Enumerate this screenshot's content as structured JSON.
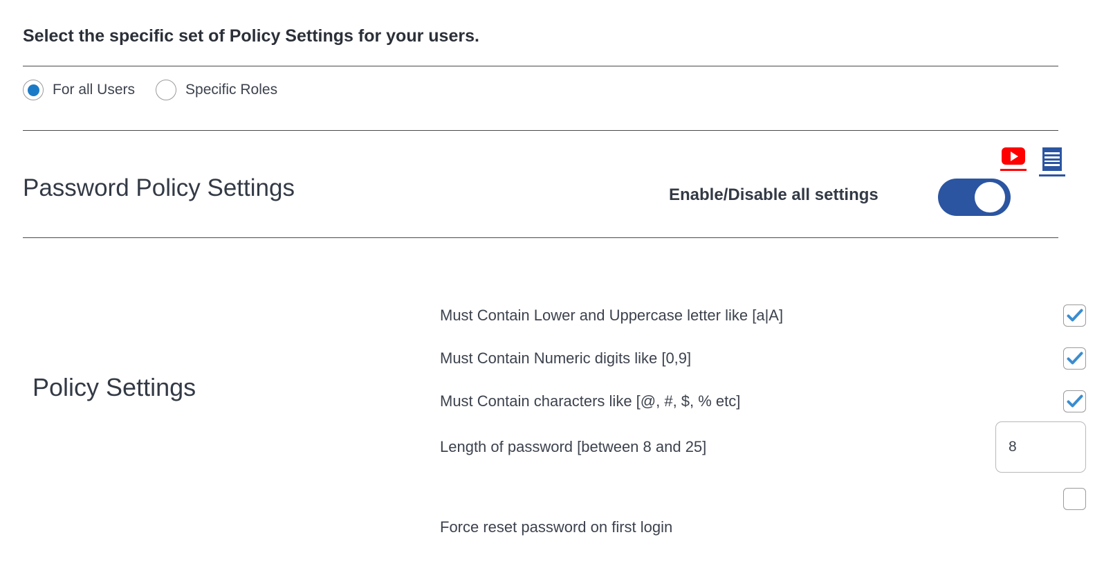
{
  "instruction": "Select the specific set of Policy Settings for your users.",
  "audience": {
    "options": [
      {
        "label": "For all Users",
        "selected": true
      },
      {
        "label": "Specific Roles",
        "selected": false
      }
    ]
  },
  "section": {
    "title": "Password Policy Settings",
    "enable_all_label": "Enable/Disable all settings",
    "enable_all_state": "on",
    "toggle_color": "#2b55a1"
  },
  "help_icons": [
    {
      "name": "video-tutorial-icon",
      "color": "#ff0000"
    },
    {
      "name": "documentation-icon",
      "color": "#2b55a1"
    }
  ],
  "policy": {
    "group_label": "Policy Settings",
    "rows": [
      {
        "label": "Must Contain Lower and Uppercase letter like [a|A]",
        "control": "checkbox",
        "checked": true
      },
      {
        "label": "Must Contain Numeric digits like [0,9]",
        "control": "checkbox",
        "checked": true
      },
      {
        "label": "Must Contain characters like [@, #, $, % etc]",
        "control": "checkbox",
        "checked": true
      },
      {
        "label": "Length of password [between 8 and 25]",
        "control": "number",
        "value": "8",
        "placeholder": ""
      },
      {
        "label": "Force reset password on first login",
        "control": "checkbox",
        "checked": false
      }
    ]
  },
  "colors": {
    "accent_blue": "#2b55a1",
    "check_blue": "#3a8dd0",
    "radio_blue": "#1b7ac6",
    "text": "#3c424d",
    "red": "#ff0000"
  }
}
